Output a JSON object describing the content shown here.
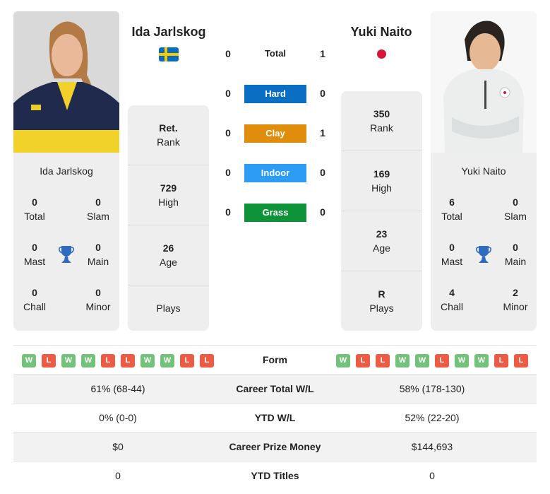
{
  "players": {
    "left": {
      "name": "Ida Jarlskog",
      "country_flag": "sweden-flag",
      "photo": "player-photo",
      "titles": {
        "total": {
          "value": "0",
          "label": "Total"
        },
        "slam": {
          "value": "0",
          "label": "Slam"
        },
        "mast": {
          "value": "0",
          "label": "Mast"
        },
        "main": {
          "value": "0",
          "label": "Main"
        },
        "chall": {
          "value": "0",
          "label": "Chall"
        },
        "minor": {
          "value": "0",
          "label": "Minor"
        }
      },
      "stats": [
        {
          "value": "Ret.",
          "label": "Rank"
        },
        {
          "value": "729",
          "label": "High"
        },
        {
          "value": "26",
          "label": "Age"
        },
        {
          "value": "",
          "label": "Plays"
        }
      ],
      "form": [
        "W",
        "L",
        "W",
        "W",
        "L",
        "L",
        "W",
        "W",
        "L",
        "L"
      ]
    },
    "right": {
      "name": "Yuki Naito",
      "country_flag": "japan-flag",
      "photo": "player-photo",
      "titles": {
        "total": {
          "value": "6",
          "label": "Total"
        },
        "slam": {
          "value": "0",
          "label": "Slam"
        },
        "mast": {
          "value": "0",
          "label": "Mast"
        },
        "main": {
          "value": "0",
          "label": "Main"
        },
        "chall": {
          "value": "4",
          "label": "Chall"
        },
        "minor": {
          "value": "2",
          "label": "Minor"
        }
      },
      "stats": [
        {
          "value": "350",
          "label": "Rank"
        },
        {
          "value": "169",
          "label": "High"
        },
        {
          "value": "23",
          "label": "Age"
        },
        {
          "value": "R",
          "label": "Plays"
        }
      ],
      "form": [
        "W",
        "L",
        "L",
        "W",
        "W",
        "L",
        "W",
        "W",
        "L",
        "L"
      ]
    }
  },
  "h2h": {
    "total": {
      "label": "Total",
      "left": "0",
      "right": "1"
    },
    "surfaces": [
      {
        "label": "Hard",
        "left": "0",
        "right": "0",
        "color": "#0a6fc2"
      },
      {
        "label": "Clay",
        "left": "0",
        "right": "1",
        "color": "#df8d0a"
      },
      {
        "label": "Indoor",
        "left": "0",
        "right": "0",
        "color": "#2d9cf5"
      },
      {
        "label": "Grass",
        "left": "0",
        "right": "0",
        "color": "#0e9339"
      }
    ]
  },
  "comparison": {
    "form_label": "Form",
    "rows": [
      {
        "label": "Career Total W/L",
        "left": "61% (68-44)",
        "right": "58% (178-130)"
      },
      {
        "label": "YTD W/L",
        "left": "0% (0-0)",
        "right": "52% (22-20)"
      },
      {
        "label": "Career Prize Money",
        "left": "$0",
        "right": "$144,693"
      },
      {
        "label": "YTD Titles",
        "left": "0",
        "right": "0"
      }
    ]
  },
  "icons": {
    "trophy": "trophy-icon"
  },
  "colors": {
    "win": "#72c27a",
    "loss": "#ee5b45",
    "trophy": "#2f6bbf",
    "panel": "#eeeeee"
  }
}
